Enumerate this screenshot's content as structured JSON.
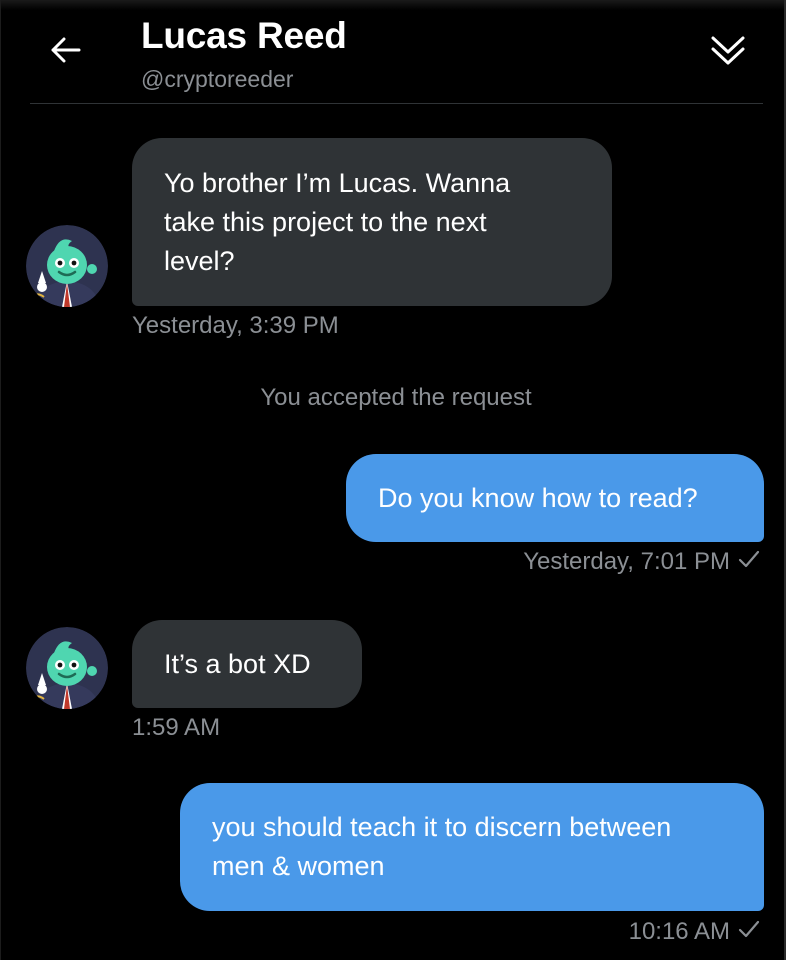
{
  "header": {
    "name": "Lucas Reed",
    "handle": "@cryptoreeder",
    "back_icon": "arrow-left-icon",
    "collapse_icon": "double-chevron-down-icon"
  },
  "colors": {
    "background": "#000000",
    "incoming_bubble": "#2f3336",
    "outgoing_bubble": "#4a99e9",
    "secondary_text": "#8b8f94"
  },
  "messages": [
    {
      "direction": "incoming",
      "text": "Yo brother I’m Lucas. Wanna\ntake this project to the next\nlevel?",
      "timestamp": "Yesterday, 3:39 PM"
    },
    {
      "direction": "system",
      "text": "You accepted the request"
    },
    {
      "direction": "outgoing",
      "text": "Do you know how to read?",
      "timestamp": "Yesterday, 7:01 PM"
    },
    {
      "direction": "incoming",
      "text": "It’s a bot XD",
      "timestamp": "1:59 AM"
    },
    {
      "direction": "outgoing",
      "text": "you should teach it to discern between\nmen & women",
      "timestamp": "10:16 AM"
    }
  ]
}
